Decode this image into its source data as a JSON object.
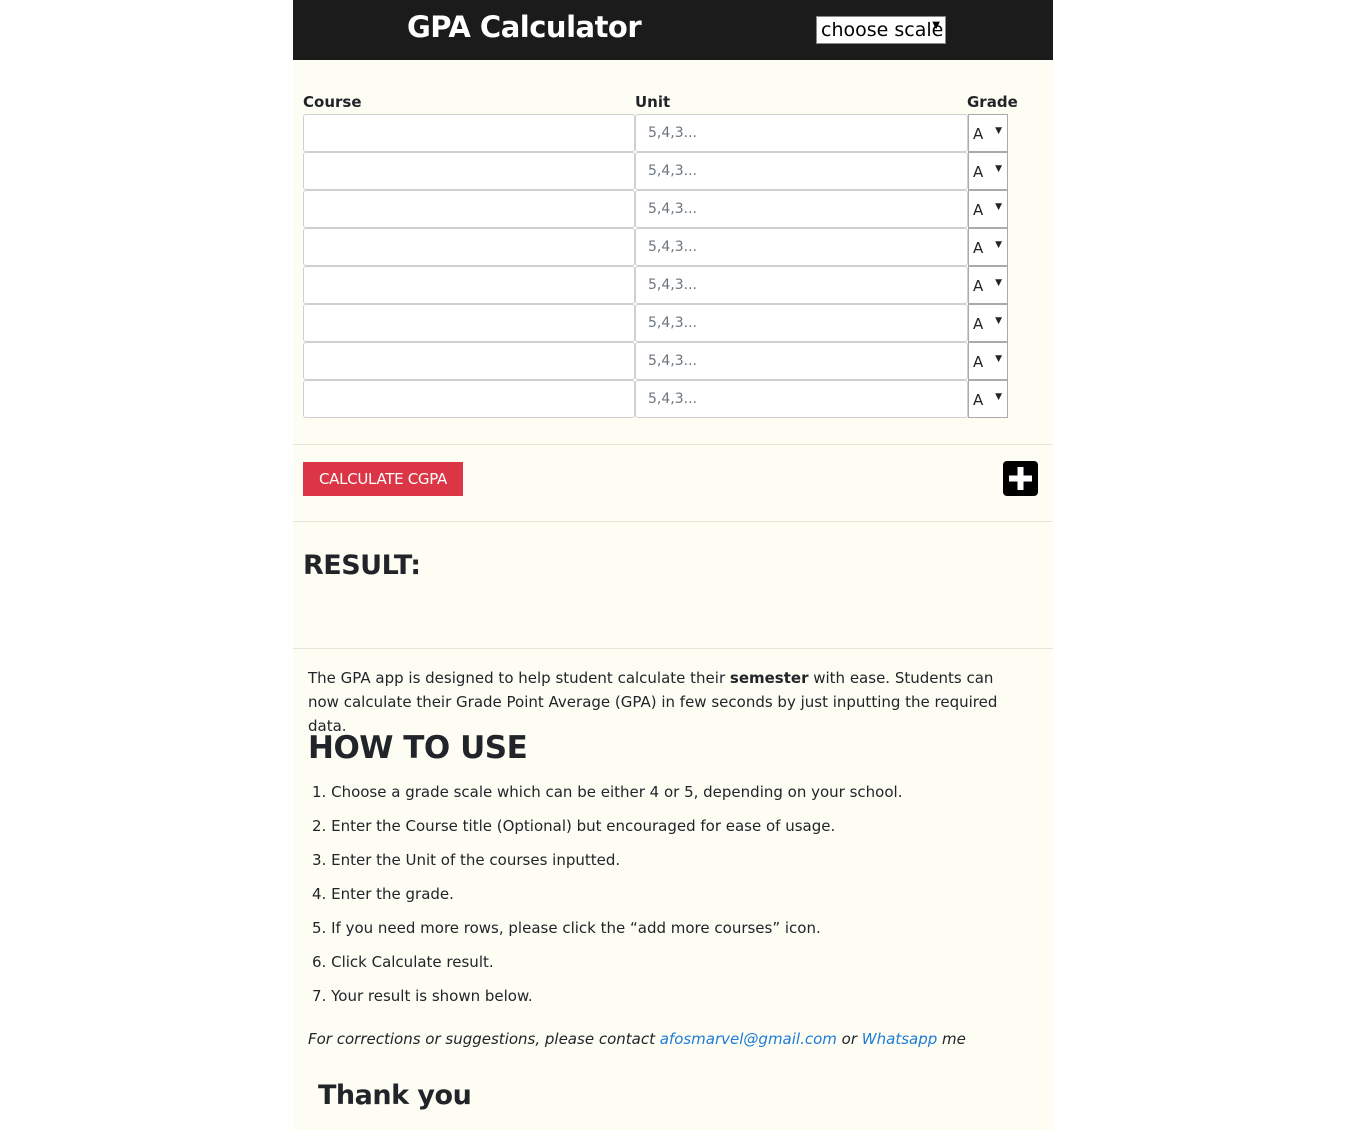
{
  "header": {
    "title": "GPA Calculator",
    "scale_select": {
      "selected": "choose scale"
    }
  },
  "table": {
    "headers": {
      "course": "Course",
      "unit": "Unit",
      "grade": "Grade"
    },
    "unit_placeholder": "5,4,3...",
    "rows": [
      {
        "course": "",
        "unit": "",
        "grade": "A"
      },
      {
        "course": "",
        "unit": "",
        "grade": "A"
      },
      {
        "course": "",
        "unit": "",
        "grade": "A"
      },
      {
        "course": "",
        "unit": "",
        "grade": "A"
      },
      {
        "course": "",
        "unit": "",
        "grade": "A"
      },
      {
        "course": "",
        "unit": "",
        "grade": "A"
      },
      {
        "course": "",
        "unit": "",
        "grade": "A"
      },
      {
        "course": "",
        "unit": "",
        "grade": "A"
      }
    ]
  },
  "actions": {
    "calculate_label": "CALCULATE CGPA",
    "add_icon": "plus-square-icon"
  },
  "result": {
    "heading": "RESULT:"
  },
  "intro": {
    "before": "The GPA app is designed to help student calculate their ",
    "bold": "semester",
    "after": " with ease. Students can now calculate their Grade Point Average (GPA) in few seconds by just inputting the required data."
  },
  "howto": {
    "heading": "HOW TO USE",
    "steps": [
      "Choose a grade scale which can be either 4 or 5, depending on your school.",
      "Enter the Course title (Optional) but encouraged for ease of usage.",
      "Enter the Unit of the courses inputted.",
      "Enter the grade.",
      "If you need more rows, please click the “add more courses” icon.",
      "Click Calculate result.",
      "Your result is shown below."
    ]
  },
  "contact": {
    "prefix": "For corrections or suggestions, please contact ",
    "email": "afosmarvel@gmail.com",
    "middle": " or ",
    "whatsapp": "Whatsapp",
    "suffix": " me"
  },
  "thanks": "Thank you",
  "colors": {
    "header_bg": "#1b1b1b",
    "page_bg": "#fdfdf4",
    "button_red": "#dc3545",
    "link_blue": "#1e7bd6"
  }
}
